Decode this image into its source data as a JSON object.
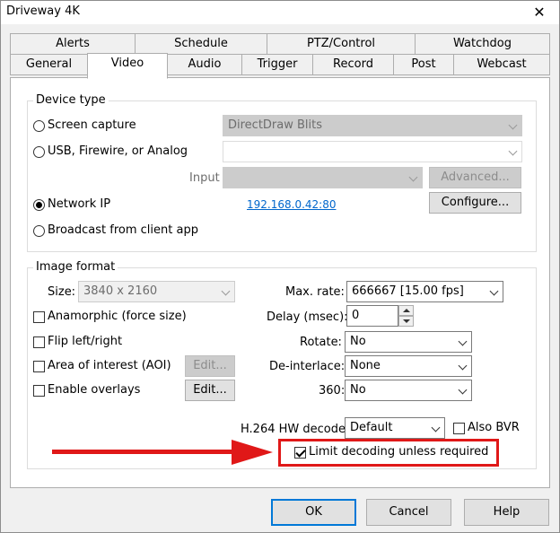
{
  "window": {
    "title": "Driveway 4K",
    "close_glyph": "✕"
  },
  "tabs_back": [
    "Alerts",
    "Schedule",
    "PTZ/Control",
    "Watchdog"
  ],
  "tabs_front": [
    "General",
    "Video",
    "Audio",
    "Trigger",
    "Record",
    "Post",
    "Webcast"
  ],
  "active_tab": "Video",
  "device_type": {
    "label": "Device type",
    "screen_capture": "Screen capture",
    "screen_capture_value": "DirectDraw Blits",
    "usb": "USB, Firewire, or Analog",
    "usb_value": "",
    "input_label": "Input",
    "input_value": "",
    "advanced_button": "Advanced...",
    "network_ip": "Network IP",
    "network_ip_link": "192.168.0.42:80",
    "configure_button": "Configure...",
    "broadcast": "Broadcast from client app",
    "selected": "Network IP"
  },
  "image_format": {
    "label": "Image format",
    "size_label": "Size:",
    "size_value": "3840 x 2160",
    "anamorphic": "Anamorphic (force size)",
    "flip": "Flip left/right",
    "aoi": "Area of interest (AOI)",
    "aoi_edit": "Edit...",
    "overlays": "Enable overlays",
    "overlays_edit": "Edit...",
    "max_rate_label": "Max. rate:",
    "max_rate_value": "666667 [15.00 fps]",
    "delay_label": "Delay (msec):",
    "delay_value": "0",
    "rotate_label": "Rotate:",
    "rotate_value": "No",
    "deinterlace_label": "De-interlace:",
    "deinterlace_value": "None",
    "label_360": "360:",
    "value_360": "No",
    "h264_label": "H.264 HW decode:",
    "h264_value": "Default",
    "also_bvr": "Also BVR",
    "limit_decoding": "Limit decoding unless required",
    "limit_decoding_checked": true
  },
  "footer": {
    "ok": "OK",
    "cancel": "Cancel",
    "help": "Help"
  },
  "colors": {
    "highlight_red": "#e01818",
    "link_blue": "#0066cc",
    "accent": "#0078d7"
  }
}
